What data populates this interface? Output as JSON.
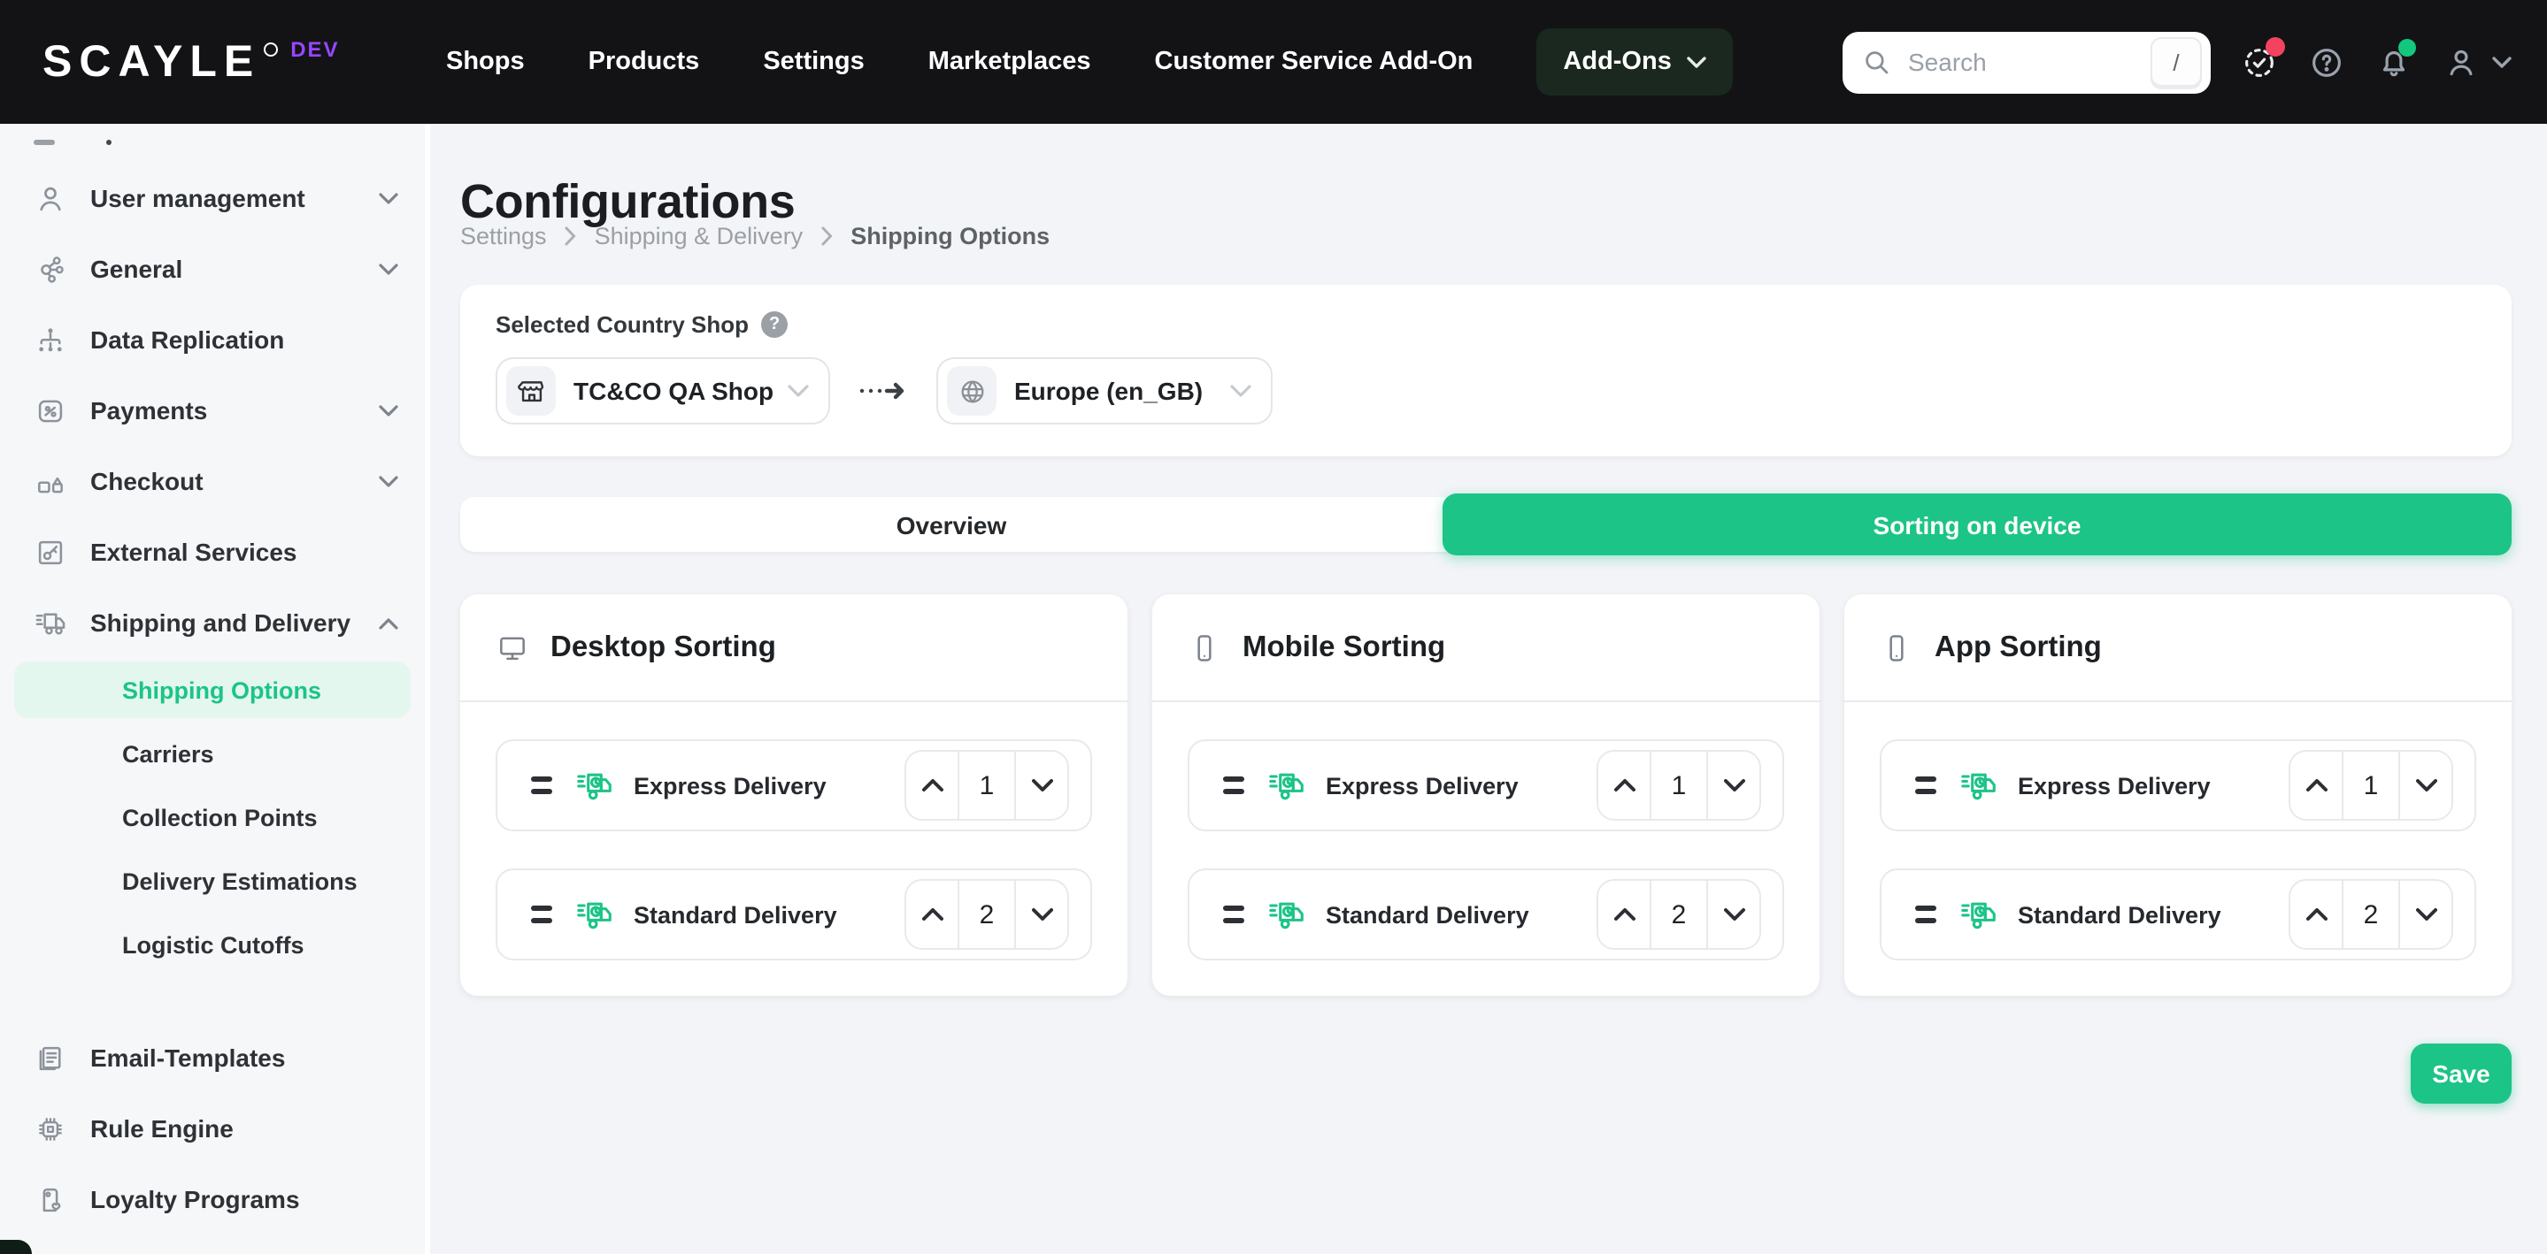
{
  "topbar": {
    "logo": "SCAYLE",
    "env_badge": "DEV",
    "nav": [
      {
        "label": "Shops"
      },
      {
        "label": "Products"
      },
      {
        "label": "Settings"
      },
      {
        "label": "Marketplaces"
      },
      {
        "label": "Customer Service Add-On"
      },
      {
        "label": "Add-Ons"
      }
    ],
    "search": {
      "placeholder": "Search",
      "shortcut": "/"
    }
  },
  "sidebar": {
    "items": [
      {
        "label": "User management"
      },
      {
        "label": "General"
      },
      {
        "label": "Data Replication"
      },
      {
        "label": "Payments"
      },
      {
        "label": "Checkout"
      },
      {
        "label": "External Services"
      },
      {
        "label": "Shipping and Delivery",
        "expanded": true,
        "children": [
          {
            "label": "Shipping Options",
            "active": true
          },
          {
            "label": "Carriers"
          },
          {
            "label": "Collection Points"
          },
          {
            "label": "Delivery Estimations"
          },
          {
            "label": "Logistic Cutoffs"
          }
        ]
      },
      {
        "label": "Email-Templates"
      },
      {
        "label": "Rule Engine"
      },
      {
        "label": "Loyalty Programs"
      }
    ]
  },
  "page": {
    "title": "Configurations",
    "breadcrumb": [
      "Settings",
      "Shipping & Delivery",
      "Shipping Options"
    ]
  },
  "shop_selector": {
    "label": "Selected Country Shop",
    "help": "?",
    "shop_value": "TC&CO QA Shop",
    "country_value": "Europe (en_GB)"
  },
  "tabs": {
    "items": [
      {
        "label": "Overview",
        "active": false
      },
      {
        "label": "Sorting on device",
        "active": true
      }
    ]
  },
  "sorting": {
    "cards": [
      {
        "title": "Desktop Sorting",
        "device": "desktop",
        "rows": [
          {
            "label": "Express Delivery",
            "position": "1"
          },
          {
            "label": "Standard Delivery",
            "position": "2"
          }
        ]
      },
      {
        "title": "Mobile Sorting",
        "device": "mobile",
        "rows": [
          {
            "label": "Express Delivery",
            "position": "1"
          },
          {
            "label": "Standard Delivery",
            "position": "2"
          }
        ]
      },
      {
        "title": "App Sorting",
        "device": "app",
        "rows": [
          {
            "label": "Express Delivery",
            "position": "1"
          },
          {
            "label": "Standard Delivery",
            "position": "2"
          }
        ]
      }
    ]
  },
  "actions": {
    "save_label": "Save"
  },
  "colors": {
    "accent_green": "#1cc487",
    "accent_green_light": "#e3f7ee",
    "topbar_bg": "#131316",
    "dev_purple": "#9747ff",
    "badge_red": "#f4435e",
    "badge_green": "#14c77e"
  }
}
